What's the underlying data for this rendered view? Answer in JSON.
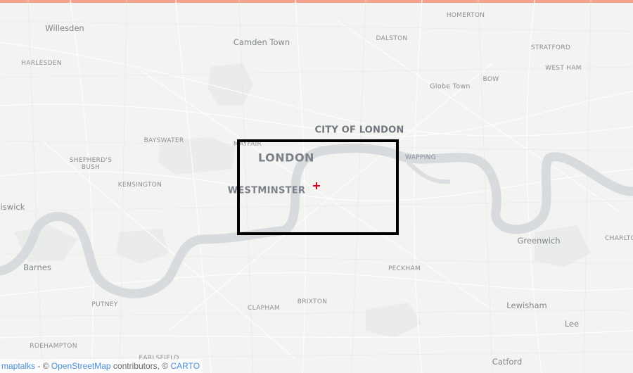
{
  "colors": {
    "top_bar": "#f4a28c",
    "land": "#f3f3f1",
    "water": "#d7dbdd",
    "roads": "#ffffff",
    "extent_box": "#000000",
    "marker": "#e0001b",
    "link": "#4a8fd6"
  },
  "labels": {
    "willesden": "Willesden",
    "camden_town": "Camden Town",
    "homerton": "HOMERTON",
    "dalston": "DALSTON",
    "stratford": "STRATFORD",
    "harlesden": "HARLESDEN",
    "west_ham": "WEST HAM",
    "bow": "BOW",
    "globe_town": "Globe Town",
    "city_of_london": "CITY OF LONDON",
    "bayswater": "BAYSWATER",
    "mayfair": "MAYFAIR",
    "wapping": "WAPPING",
    "shepherds_bush": "SHEPHERD'S\nBUSH",
    "london": "LONDON",
    "kensington": "KENSINGTON",
    "westminster": "WESTMINSTER",
    "chiswick": "iswick",
    "greenwich": "Greenwich",
    "charlton": "CHARLTO",
    "barnes": "Barnes",
    "peckham": "PECKHAM",
    "putney": "PUTNEY",
    "clapham": "CLAPHAM",
    "brixton": "BRIXTON",
    "lewisham": "Lewisham",
    "lee": "Lee",
    "roehampton": "ROEHAMPTON",
    "earlsfield": "EARLSFIELD",
    "catford": "Catford"
  },
  "attribution": {
    "maptalks": "maptalks",
    "sep1": " - © ",
    "osm": "OpenStreetMap",
    "mid": " contributors, © ",
    "carto": "CARTO"
  }
}
